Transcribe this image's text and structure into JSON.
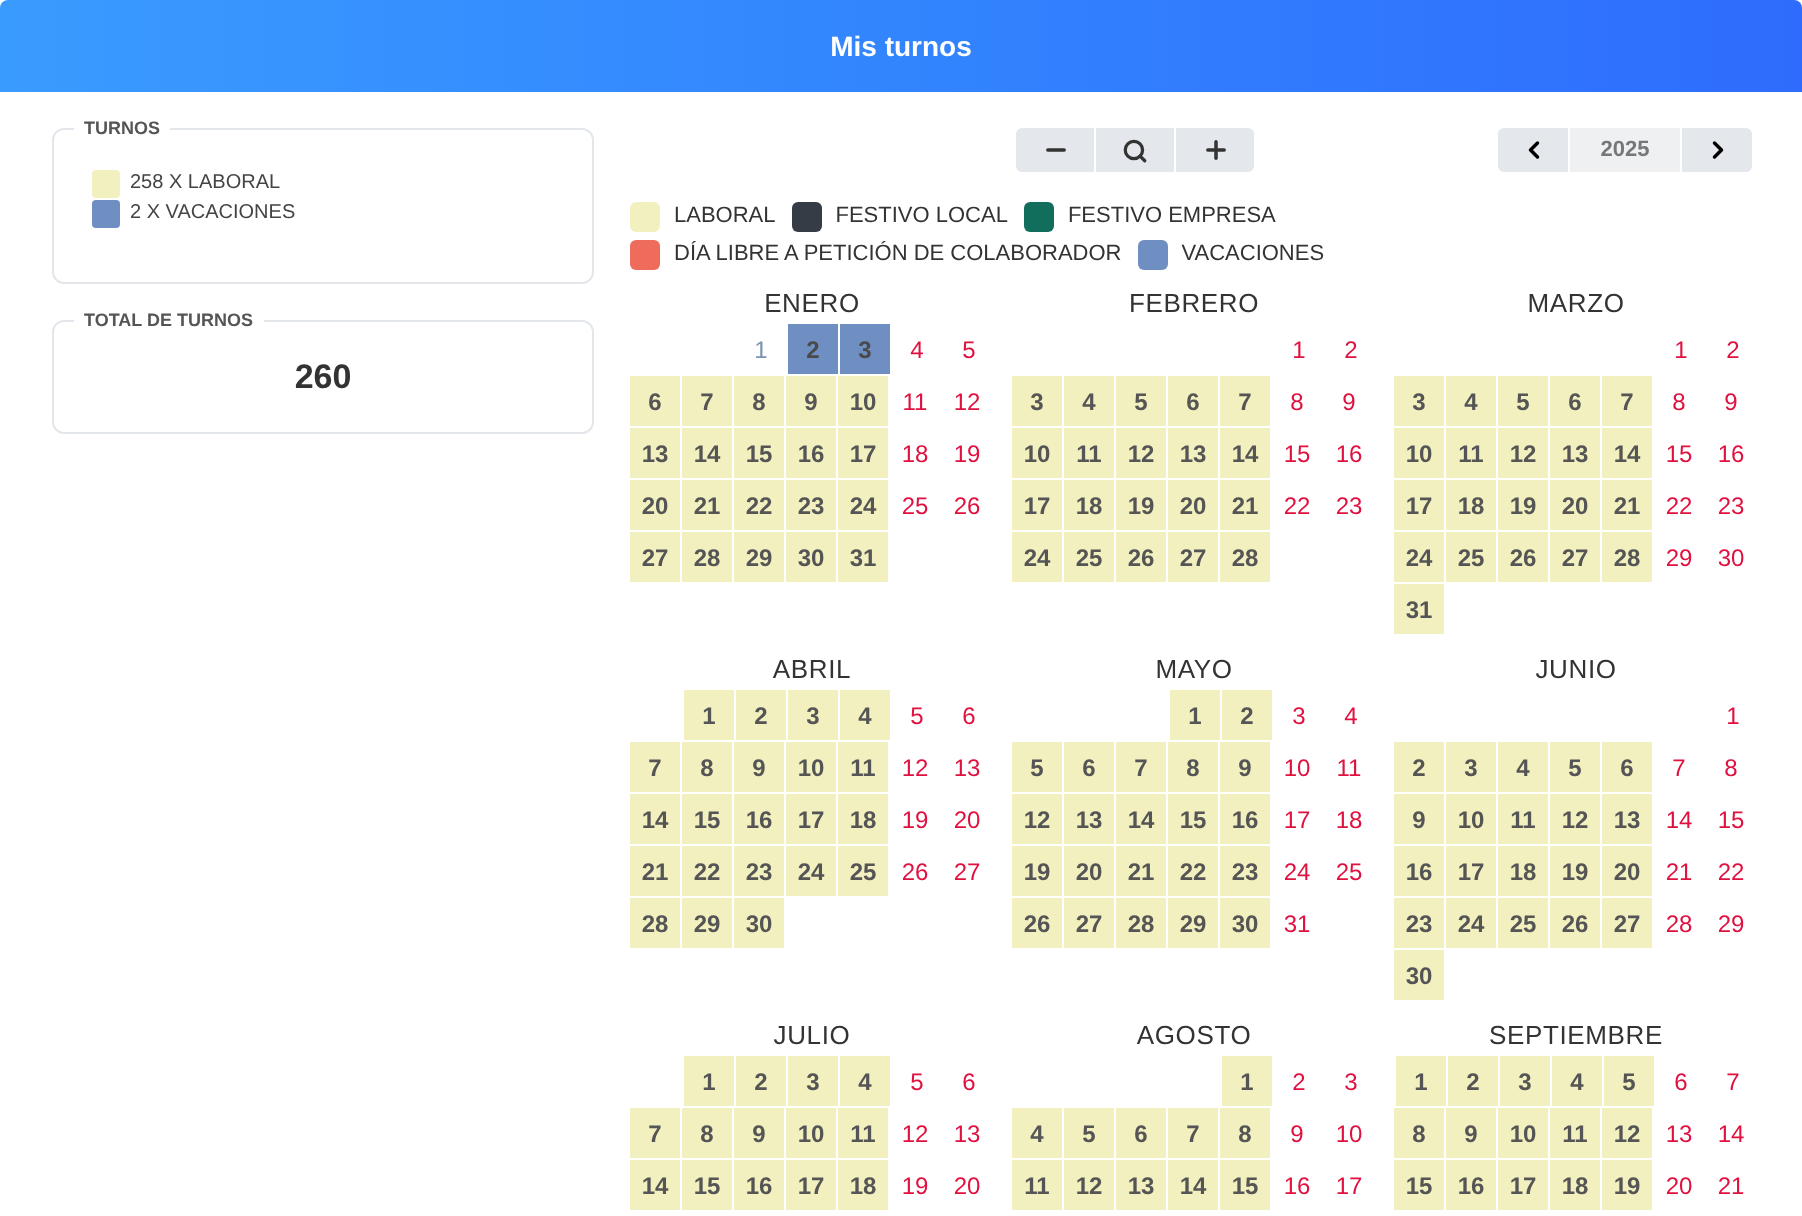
{
  "header": {
    "title": "Mis turnos"
  },
  "turnos_panel": {
    "title": "TURNOS",
    "items": [
      {
        "label": "258 X LABORAL",
        "color": "#f3f0bf"
      },
      {
        "label": "2 X VACACIONES",
        "color": "#6f8fc2"
      }
    ]
  },
  "total_panel": {
    "title": "TOTAL DE TURNOS",
    "value": "260"
  },
  "zoom_controls": [
    {
      "kind": "minus"
    },
    {
      "kind": "search"
    },
    {
      "kind": "plus"
    }
  ],
  "year_nav": {
    "year": "2025"
  },
  "legend": [
    {
      "label": "LABORAL",
      "color": "#f3f0bf"
    },
    {
      "label": "FESTIVO LOCAL",
      "color": "#353c45"
    },
    {
      "label": "FESTIVO EMPRESA",
      "color": "#126e5c"
    },
    {
      "label": "DÍA LIBRE A PETICIÓN DE COLABORADOR",
      "color": "#ef6b5b"
    },
    {
      "label": "VACACIONES",
      "color": "#6f8fc2"
    }
  ],
  "months": [
    {
      "name": "ENERO",
      "weeks": [
        [
          {
            "day": "1",
            "kind": "festivo"
          },
          {
            "day": "2",
            "kind": "vacaciones"
          },
          {
            "day": "3",
            "kind": "vacaciones"
          },
          {
            "day": "4",
            "kind": "libre"
          },
          {
            "day": "5",
            "kind": "libre"
          }
        ],
        [
          {
            "day": "6",
            "kind": "laboral"
          },
          {
            "day": "7",
            "kind": "laboral"
          },
          {
            "day": "8",
            "kind": "laboral"
          },
          {
            "day": "9",
            "kind": "laboral"
          },
          {
            "day": "10",
            "kind": "laboral"
          },
          {
            "day": "11",
            "kind": "libre"
          },
          {
            "day": "12",
            "kind": "libre"
          }
        ],
        [
          {
            "day": "13",
            "kind": "laboral"
          },
          {
            "day": "14",
            "kind": "laboral"
          },
          {
            "day": "15",
            "kind": "laboral"
          },
          {
            "day": "16",
            "kind": "laboral"
          },
          {
            "day": "17",
            "kind": "laboral"
          },
          {
            "day": "18",
            "kind": "libre"
          },
          {
            "day": "19",
            "kind": "libre"
          }
        ],
        [
          {
            "day": "20",
            "kind": "laboral"
          },
          {
            "day": "21",
            "kind": "laboral"
          },
          {
            "day": "22",
            "kind": "laboral"
          },
          {
            "day": "23",
            "kind": "laboral"
          },
          {
            "day": "24",
            "kind": "laboral"
          },
          {
            "day": "25",
            "kind": "libre"
          },
          {
            "day": "26",
            "kind": "libre"
          }
        ],
        [
          {
            "day": "27",
            "kind": "laboral"
          },
          {
            "day": "28",
            "kind": "laboral"
          },
          {
            "day": "29",
            "kind": "laboral"
          },
          {
            "day": "30",
            "kind": "laboral"
          },
          {
            "day": "31",
            "kind": "laboral"
          }
        ]
      ]
    },
    {
      "name": "FEBRERO",
      "weeks": [
        [
          {
            "day": "1",
            "kind": "libre"
          },
          {
            "day": "2",
            "kind": "libre"
          }
        ],
        [
          {
            "day": "3",
            "kind": "laboral"
          },
          {
            "day": "4",
            "kind": "laboral"
          },
          {
            "day": "5",
            "kind": "laboral"
          },
          {
            "day": "6",
            "kind": "laboral"
          },
          {
            "day": "7",
            "kind": "laboral"
          },
          {
            "day": "8",
            "kind": "libre"
          },
          {
            "day": "9",
            "kind": "libre"
          }
        ],
        [
          {
            "day": "10",
            "kind": "laboral"
          },
          {
            "day": "11",
            "kind": "laboral"
          },
          {
            "day": "12",
            "kind": "laboral"
          },
          {
            "day": "13",
            "kind": "laboral"
          },
          {
            "day": "14",
            "kind": "laboral"
          },
          {
            "day": "15",
            "kind": "libre"
          },
          {
            "day": "16",
            "kind": "libre"
          }
        ],
        [
          {
            "day": "17",
            "kind": "laboral"
          },
          {
            "day": "18",
            "kind": "laboral"
          },
          {
            "day": "19",
            "kind": "laboral"
          },
          {
            "day": "20",
            "kind": "laboral"
          },
          {
            "day": "21",
            "kind": "laboral"
          },
          {
            "day": "22",
            "kind": "libre"
          },
          {
            "day": "23",
            "kind": "libre"
          }
        ],
        [
          {
            "day": "24",
            "kind": "laboral"
          },
          {
            "day": "25",
            "kind": "laboral"
          },
          {
            "day": "26",
            "kind": "laboral"
          },
          {
            "day": "27",
            "kind": "laboral"
          },
          {
            "day": "28",
            "kind": "laboral"
          }
        ]
      ]
    },
    {
      "name": "MARZO",
      "weeks": [
        [
          {
            "day": "1",
            "kind": "libre"
          },
          {
            "day": "2",
            "kind": "libre"
          }
        ],
        [
          {
            "day": "3",
            "kind": "laboral"
          },
          {
            "day": "4",
            "kind": "laboral"
          },
          {
            "day": "5",
            "kind": "laboral"
          },
          {
            "day": "6",
            "kind": "laboral"
          },
          {
            "day": "7",
            "kind": "laboral"
          },
          {
            "day": "8",
            "kind": "libre"
          },
          {
            "day": "9",
            "kind": "libre"
          }
        ],
        [
          {
            "day": "10",
            "kind": "laboral"
          },
          {
            "day": "11",
            "kind": "laboral"
          },
          {
            "day": "12",
            "kind": "laboral"
          },
          {
            "day": "13",
            "kind": "laboral"
          },
          {
            "day": "14",
            "kind": "laboral"
          },
          {
            "day": "15",
            "kind": "libre"
          },
          {
            "day": "16",
            "kind": "libre"
          }
        ],
        [
          {
            "day": "17",
            "kind": "laboral"
          },
          {
            "day": "18",
            "kind": "laboral"
          },
          {
            "day": "19",
            "kind": "laboral"
          },
          {
            "day": "20",
            "kind": "laboral"
          },
          {
            "day": "21",
            "kind": "laboral"
          },
          {
            "day": "22",
            "kind": "libre"
          },
          {
            "day": "23",
            "kind": "libre"
          }
        ],
        [
          {
            "day": "24",
            "kind": "laboral"
          },
          {
            "day": "25",
            "kind": "laboral"
          },
          {
            "day": "26",
            "kind": "laboral"
          },
          {
            "day": "27",
            "kind": "laboral"
          },
          {
            "day": "28",
            "kind": "laboral"
          },
          {
            "day": "29",
            "kind": "libre"
          },
          {
            "day": "30",
            "kind": "libre"
          }
        ],
        [
          {
            "day": "31",
            "kind": "laboral"
          }
        ]
      ]
    },
    {
      "name": "ABRIL",
      "weeks": [
        [
          {
            "day": "1",
            "kind": "laboral"
          },
          {
            "day": "2",
            "kind": "laboral"
          },
          {
            "day": "3",
            "kind": "laboral"
          },
          {
            "day": "4",
            "kind": "laboral"
          },
          {
            "day": "5",
            "kind": "libre"
          },
          {
            "day": "6",
            "kind": "libre"
          }
        ],
        [
          {
            "day": "7",
            "kind": "laboral"
          },
          {
            "day": "8",
            "kind": "laboral"
          },
          {
            "day": "9",
            "kind": "laboral"
          },
          {
            "day": "10",
            "kind": "laboral"
          },
          {
            "day": "11",
            "kind": "laboral"
          },
          {
            "day": "12",
            "kind": "libre"
          },
          {
            "day": "13",
            "kind": "libre"
          }
        ],
        [
          {
            "day": "14",
            "kind": "laboral"
          },
          {
            "day": "15",
            "kind": "laboral"
          },
          {
            "day": "16",
            "kind": "laboral"
          },
          {
            "day": "17",
            "kind": "laboral"
          },
          {
            "day": "18",
            "kind": "laboral"
          },
          {
            "day": "19",
            "kind": "libre"
          },
          {
            "day": "20",
            "kind": "libre"
          }
        ],
        [
          {
            "day": "21",
            "kind": "laboral"
          },
          {
            "day": "22",
            "kind": "laboral"
          },
          {
            "day": "23",
            "kind": "laboral"
          },
          {
            "day": "24",
            "kind": "laboral"
          },
          {
            "day": "25",
            "kind": "laboral"
          },
          {
            "day": "26",
            "kind": "libre"
          },
          {
            "day": "27",
            "kind": "libre"
          }
        ],
        [
          {
            "day": "28",
            "kind": "laboral"
          },
          {
            "day": "29",
            "kind": "laboral"
          },
          {
            "day": "30",
            "kind": "laboral"
          }
        ]
      ]
    },
    {
      "name": "MAYO",
      "weeks": [
        [
          {
            "day": "1",
            "kind": "laboral"
          },
          {
            "day": "2",
            "kind": "laboral"
          },
          {
            "day": "3",
            "kind": "libre"
          },
          {
            "day": "4",
            "kind": "libre"
          }
        ],
        [
          {
            "day": "5",
            "kind": "laboral"
          },
          {
            "day": "6",
            "kind": "laboral"
          },
          {
            "day": "7",
            "kind": "laboral"
          },
          {
            "day": "8",
            "kind": "laboral"
          },
          {
            "day": "9",
            "kind": "laboral"
          },
          {
            "day": "10",
            "kind": "libre"
          },
          {
            "day": "11",
            "kind": "libre"
          }
        ],
        [
          {
            "day": "12",
            "kind": "laboral"
          },
          {
            "day": "13",
            "kind": "laboral"
          },
          {
            "day": "14",
            "kind": "laboral"
          },
          {
            "day": "15",
            "kind": "laboral"
          },
          {
            "day": "16",
            "kind": "laboral"
          },
          {
            "day": "17",
            "kind": "libre"
          },
          {
            "day": "18",
            "kind": "libre"
          }
        ],
        [
          {
            "day": "19",
            "kind": "laboral"
          },
          {
            "day": "20",
            "kind": "laboral"
          },
          {
            "day": "21",
            "kind": "laboral"
          },
          {
            "day": "22",
            "kind": "laboral"
          },
          {
            "day": "23",
            "kind": "laboral"
          },
          {
            "day": "24",
            "kind": "libre"
          },
          {
            "day": "25",
            "kind": "libre"
          }
        ],
        [
          {
            "day": "26",
            "kind": "laboral"
          },
          {
            "day": "27",
            "kind": "laboral"
          },
          {
            "day": "28",
            "kind": "laboral"
          },
          {
            "day": "29",
            "kind": "laboral"
          },
          {
            "day": "30",
            "kind": "laboral"
          },
          {
            "day": "31",
            "kind": "libre"
          }
        ]
      ]
    },
    {
      "name": "JUNIO",
      "weeks": [
        [
          {
            "day": "1",
            "kind": "libre"
          }
        ],
        [
          {
            "day": "2",
            "kind": "laboral"
          },
          {
            "day": "3",
            "kind": "laboral"
          },
          {
            "day": "4",
            "kind": "laboral"
          },
          {
            "day": "5",
            "kind": "laboral"
          },
          {
            "day": "6",
            "kind": "laboral"
          },
          {
            "day": "7",
            "kind": "libre"
          },
          {
            "day": "8",
            "kind": "libre"
          }
        ],
        [
          {
            "day": "9",
            "kind": "laboral"
          },
          {
            "day": "10",
            "kind": "laboral"
          },
          {
            "day": "11",
            "kind": "laboral"
          },
          {
            "day": "12",
            "kind": "laboral"
          },
          {
            "day": "13",
            "kind": "laboral"
          },
          {
            "day": "14",
            "kind": "libre"
          },
          {
            "day": "15",
            "kind": "libre"
          }
        ],
        [
          {
            "day": "16",
            "kind": "laboral"
          },
          {
            "day": "17",
            "kind": "laboral"
          },
          {
            "day": "18",
            "kind": "laboral"
          },
          {
            "day": "19",
            "kind": "laboral"
          },
          {
            "day": "20",
            "kind": "laboral"
          },
          {
            "day": "21",
            "kind": "libre"
          },
          {
            "day": "22",
            "kind": "libre"
          }
        ],
        [
          {
            "day": "23",
            "kind": "laboral"
          },
          {
            "day": "24",
            "kind": "laboral"
          },
          {
            "day": "25",
            "kind": "laboral"
          },
          {
            "day": "26",
            "kind": "laboral"
          },
          {
            "day": "27",
            "kind": "laboral"
          },
          {
            "day": "28",
            "kind": "libre"
          },
          {
            "day": "29",
            "kind": "libre"
          }
        ],
        [
          {
            "day": "30",
            "kind": "laboral"
          }
        ]
      ]
    },
    {
      "name": "JULIO",
      "weeks": [
        [
          {
            "day": "1",
            "kind": "laboral"
          },
          {
            "day": "2",
            "kind": "laboral"
          },
          {
            "day": "3",
            "kind": "laboral"
          },
          {
            "day": "4",
            "kind": "laboral"
          },
          {
            "day": "5",
            "kind": "libre"
          },
          {
            "day": "6",
            "kind": "libre"
          }
        ],
        [
          {
            "day": "7",
            "kind": "laboral"
          },
          {
            "day": "8",
            "kind": "laboral"
          },
          {
            "day": "9",
            "kind": "laboral"
          },
          {
            "day": "10",
            "kind": "laboral"
          },
          {
            "day": "11",
            "kind": "laboral"
          },
          {
            "day": "12",
            "kind": "libre"
          },
          {
            "day": "13",
            "kind": "libre"
          }
        ],
        [
          {
            "day": "14",
            "kind": "laboral"
          },
          {
            "day": "15",
            "kind": "laboral"
          },
          {
            "day": "16",
            "kind": "laboral"
          },
          {
            "day": "17",
            "kind": "laboral"
          },
          {
            "day": "18",
            "kind": "laboral"
          },
          {
            "day": "19",
            "kind": "libre"
          },
          {
            "day": "20",
            "kind": "libre"
          }
        ]
      ]
    },
    {
      "name": "AGOSTO",
      "weeks": [
        [
          {
            "day": "1",
            "kind": "laboral"
          },
          {
            "day": "2",
            "kind": "libre"
          },
          {
            "day": "3",
            "kind": "libre"
          }
        ],
        [
          {
            "day": "4",
            "kind": "laboral"
          },
          {
            "day": "5",
            "kind": "laboral"
          },
          {
            "day": "6",
            "kind": "laboral"
          },
          {
            "day": "7",
            "kind": "laboral"
          },
          {
            "day": "8",
            "kind": "laboral"
          },
          {
            "day": "9",
            "kind": "libre"
          },
          {
            "day": "10",
            "kind": "libre"
          }
        ],
        [
          {
            "day": "11",
            "kind": "laboral"
          },
          {
            "day": "12",
            "kind": "laboral"
          },
          {
            "day": "13",
            "kind": "laboral"
          },
          {
            "day": "14",
            "kind": "laboral"
          },
          {
            "day": "15",
            "kind": "laboral"
          },
          {
            "day": "16",
            "kind": "libre"
          },
          {
            "day": "17",
            "kind": "libre"
          }
        ]
      ]
    },
    {
      "name": "SEPTIEMBRE",
      "weeks": [
        [
          {
            "day": "1",
            "kind": "laboral"
          },
          {
            "day": "2",
            "kind": "laboral"
          },
          {
            "day": "3",
            "kind": "laboral"
          },
          {
            "day": "4",
            "kind": "laboral"
          },
          {
            "day": "5",
            "kind": "laboral"
          },
          {
            "day": "6",
            "kind": "libre"
          },
          {
            "day": "7",
            "kind": "libre"
          }
        ],
        [
          {
            "day": "8",
            "kind": "laboral"
          },
          {
            "day": "9",
            "kind": "laboral"
          },
          {
            "day": "10",
            "kind": "laboral"
          },
          {
            "day": "11",
            "kind": "laboral"
          },
          {
            "day": "12",
            "kind": "laboral"
          },
          {
            "day": "13",
            "kind": "libre"
          },
          {
            "day": "14",
            "kind": "libre"
          }
        ],
        [
          {
            "day": "15",
            "kind": "laboral"
          },
          {
            "day": "16",
            "kind": "laboral"
          },
          {
            "day": "17",
            "kind": "laboral"
          },
          {
            "day": "18",
            "kind": "laboral"
          },
          {
            "day": "19",
            "kind": "laboral"
          },
          {
            "day": "20",
            "kind": "libre"
          },
          {
            "day": "21",
            "kind": "libre"
          }
        ]
      ]
    }
  ]
}
